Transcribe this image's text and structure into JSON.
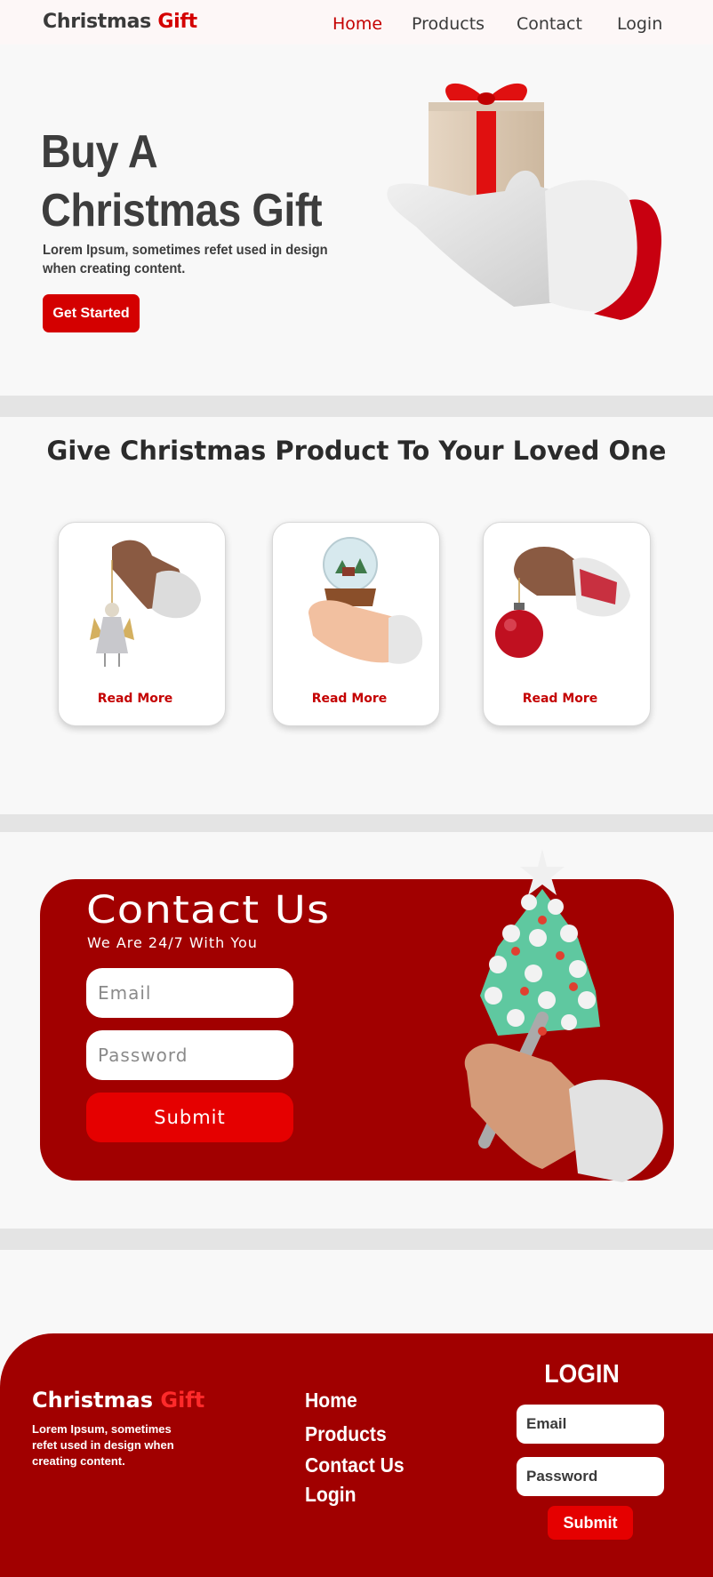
{
  "nav": {
    "brand_main": "Christmas",
    "brand_accent": "Gift",
    "links": [
      "Home",
      "Products",
      "Contact",
      "Login"
    ]
  },
  "hero": {
    "title": "Buy A Christmas Gift",
    "subtitle": "Lorem Ipsum, sometimes refet used in design when creating content.",
    "cta": "Get Started"
  },
  "products": {
    "title": "Give Christmas Product To Your Loved One",
    "cards": [
      {
        "image": "hand-holding-angel-ornament",
        "link": "Read More"
      },
      {
        "image": "hand-holding-snow-globe",
        "link": "Read More"
      },
      {
        "image": "hand-holding-red-bauble",
        "link": "Read More"
      }
    ]
  },
  "contact": {
    "title": "Contact Us",
    "subtitle": "We Are 24/7 With You",
    "email_placeholder": "Email",
    "password_placeholder": "Password",
    "submit": "Submit"
  },
  "footer": {
    "brand_main": "Christmas",
    "brand_accent": "Gift",
    "description": "Lorem Ipsum, sometimes refet used in design when creating content.",
    "links": [
      "Home",
      "Products",
      "Contact Us",
      "Login"
    ],
    "login_title": "LOGIN",
    "email_placeholder": "Email",
    "password_placeholder": "Password",
    "submit": "Submit"
  },
  "colors": {
    "brand_red": "#d40000",
    "dark_red": "#a10000",
    "bright_red": "#e50000",
    "text_dark": "#3d3d3d"
  }
}
